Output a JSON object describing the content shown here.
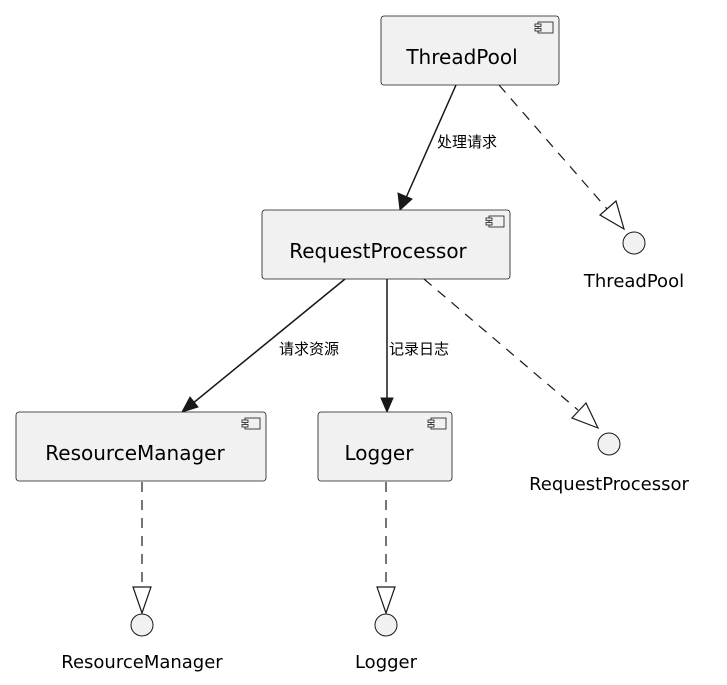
{
  "components": {
    "threadpool": "ThreadPool",
    "requestprocessor": "RequestProcessor",
    "resourcemanager": "ResourceManager",
    "logger": "Logger"
  },
  "interfaces": {
    "threadpool": "ThreadPool",
    "requestprocessor": "RequestProcessor",
    "resourcemanager": "ResourceManager",
    "logger": "Logger"
  },
  "edges": {
    "threadpool_to_requestprocessor": "处理请求",
    "requestprocessor_to_resourcemanager": "请求资源",
    "requestprocessor_to_logger": "记录日志"
  }
}
